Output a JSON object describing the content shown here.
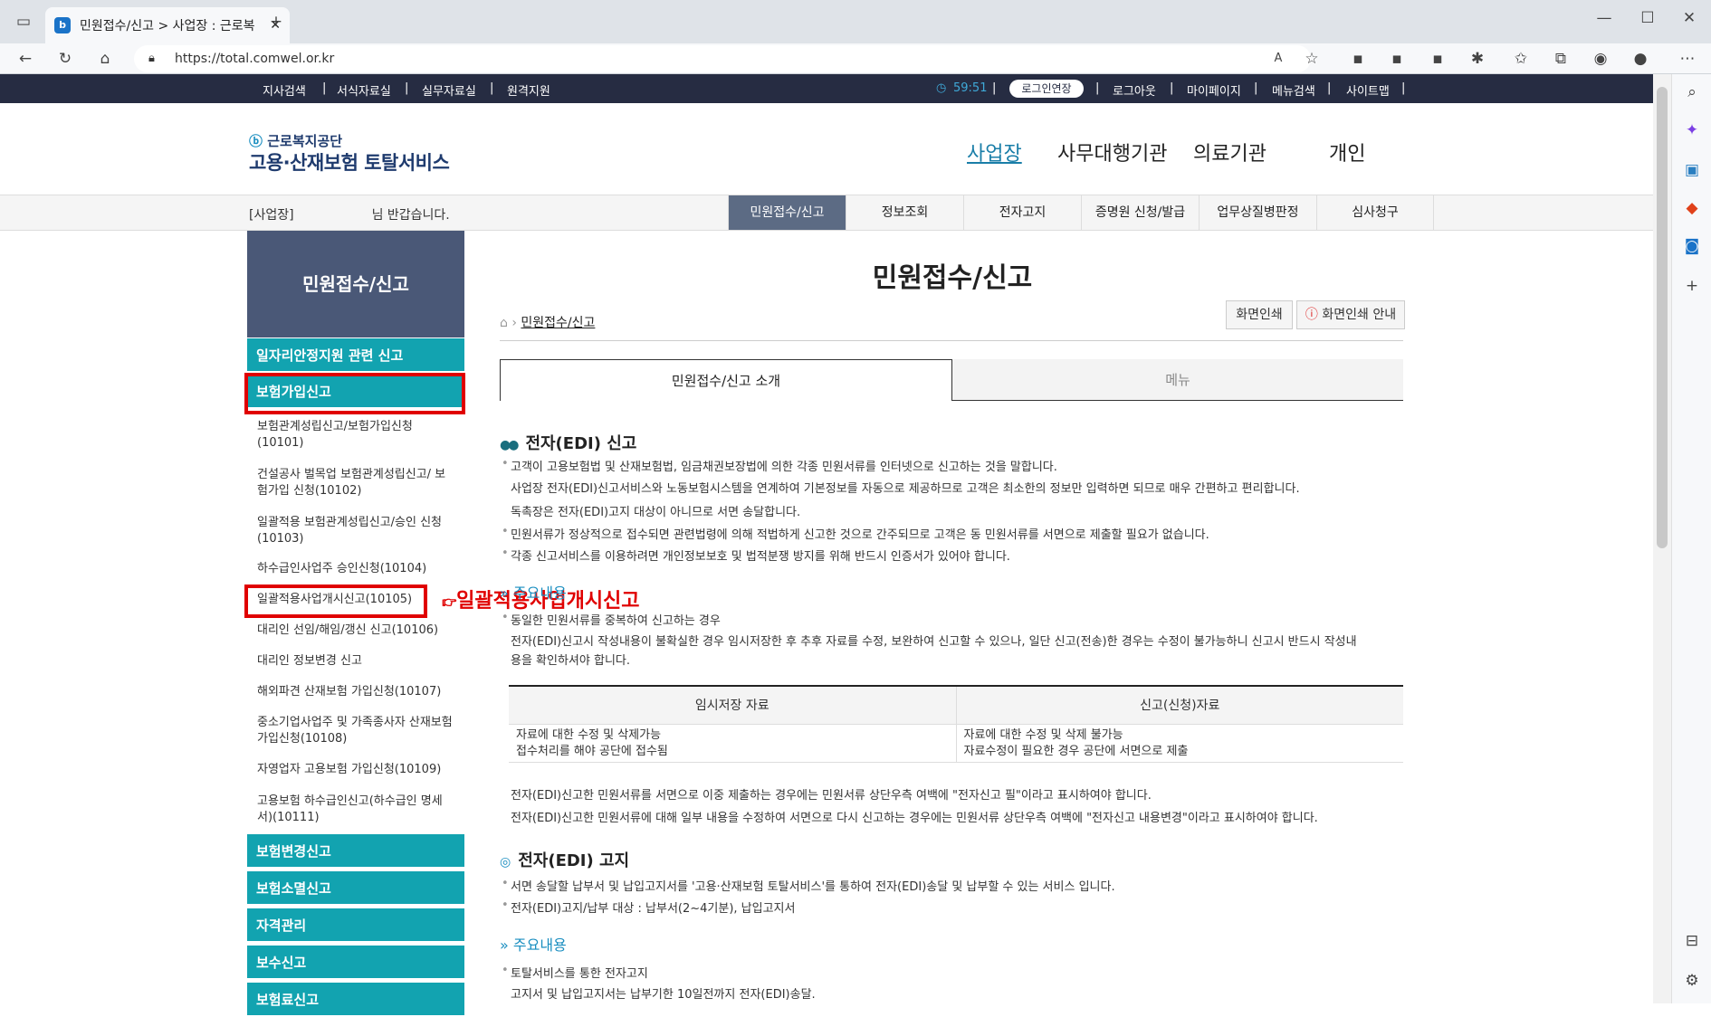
{
  "browser": {
    "tab_title": "민원접수/신고 > 사업장 : 근로복",
    "url": "https://total.comwel.or.kr"
  },
  "topbar": {
    "left_links": [
      "지사검색",
      "서식자료실",
      "실무자료실",
      "원격지원"
    ],
    "timer": "59:51",
    "login_extend": "로그인연장",
    "right_links": [
      "로그아웃",
      "마이페이지",
      "메뉴검색",
      "사이트맵"
    ]
  },
  "brand": {
    "line1": "근로복지공단",
    "line2": "고용·산재보험 토탈서비스"
  },
  "gnav": [
    "사업장",
    "사무대행기관",
    "의료기관",
    "개인"
  ],
  "welcome": {
    "prefix": "[사업장]",
    "suffix": "님 반갑습니다."
  },
  "subtabs": [
    "민원접수/신고",
    "정보조회",
    "전자고지",
    "증명원 신청/발급",
    "업무상질병판정",
    "심사청구"
  ],
  "leftnav": {
    "title": "민원접수/신고",
    "cat_top": [
      "일자리안정지원 관련 신고",
      "보험가입신고"
    ],
    "items": [
      "보험관계성립신고/보험가입신청 (10101)",
      "건설공사 벌목업 보험관계성립신고/ 보험가입 신청(10102)",
      "일괄적용 보험관계성립신고/승인 신청(10103)",
      "하수급인사업주 승인신청(10104)",
      "일괄적용사업개시신고(10105)",
      "대리인 선임/해임/갱신 신고(10106)",
      "대리인 정보변경 신고",
      "해외파견 산재보험 가입신청(10107)",
      "중소기업사업주 및 가족종사자 산재보험가입신청(10108)",
      "자영업자 고용보험 가입신청(10109)",
      "고용보험 하수급인신고(하수급인 명세서)(10111)"
    ],
    "cat_bottom": [
      "보험변경신고",
      "보험소멸신고",
      "자격관리",
      "보수신고",
      "보험료신고"
    ],
    "callout": "일괄적용사업개시신고"
  },
  "main": {
    "title": "민원접수/신고",
    "breadcrumb": "민원접수/신고",
    "print_btn": "화면인쇄",
    "print_guide_btn": "화면인쇄 안내",
    "tabs": [
      "민원접수/신고 소개",
      "메뉴"
    ],
    "sec1_title": "전자(EDI) 신고",
    "sec1_lines": [
      "고객이 고용보험법 및 산재보험법, 임금채권보장법에 의한 각종 민원서류를 인터넷으로 신고하는 것을 말합니다.",
      "사업장 전자(EDI)신고서비스와 노동보험시스템을 연계하여 기본정보를 자동으로 제공하므로 고객은 최소한의 정보만 입력하면 되므로 매우 간편하고 편리합니다.",
      "독촉장은 전자(EDI)고지 대상이 아니므로 서면 송달합니다.",
      "민원서류가 정상적으로 접수되면 관련법령에 의해 적법하게 신고한 것으로 간주되므로 고객은 동 민원서류를 서면으로 제출할 필요가 없습니다.",
      "각종 신고서비스를 이용하려면 개인정보보호 및 법적분쟁 방지를 위해 반드시 인증서가 있어야 합니다."
    ],
    "sub1_title": "주요내용",
    "sub1_lines": [
      "동일한 민원서류를 중복하여 신고하는 경우",
      "전자(EDI)신고시 작성내용이 불확실한 경우 임시저장한 후 추후 자료를 수정, 보완하여 신고할 수 있으나, 일단 신고(전송)한 경우는 수정이 불가능하니 신고시 반드시 작성내",
      "용을 확인하셔야 합니다."
    ],
    "table": {
      "headers": [
        "임시저장 자료",
        "신고(신청)자료"
      ],
      "col1": [
        "자료에 대한 수정 및 삭제가능",
        "접수처리를 해야 공단에 접수됨"
      ],
      "col2": [
        "자료에 대한 수정 및 삭제 불가능",
        "자료수정이 필요한 경우 공단에 서면으로 제출"
      ]
    },
    "notes": [
      "전자(EDI)신고한 민원서류를 서면으로 이중 제출하는 경우에는 민원서류 상단우측 여백에 \"전자신고 필\"이라고 표시하여야 합니다.",
      "전자(EDI)신고한 민원서류에 대해 일부 내용을 수정하여 서면으로 다시 신고하는 경우에는 민원서류 상단우측 여백에 \"전자신고 내용변경\"이라고 표시하여야 합니다."
    ],
    "sec2_title": "전자(EDI) 고지",
    "sec2_lines": [
      "서면 송달할 납부서 및 납입고지서를 '고용·산재보험 토탈서비스'를 통하여 전자(EDI)송달 및 납부할 수 있는 서비스 입니다.",
      "전자(EDI)고지/납부 대상 : 납부서(2~4기분), 납입고지서"
    ],
    "sub2_title": "주요내용",
    "sub2_lines": [
      "토탈서비스를 통한 전자고지",
      "고지서 및 납입고지서는 납부기한 10일전까지 전자(EDI)송달."
    ]
  }
}
